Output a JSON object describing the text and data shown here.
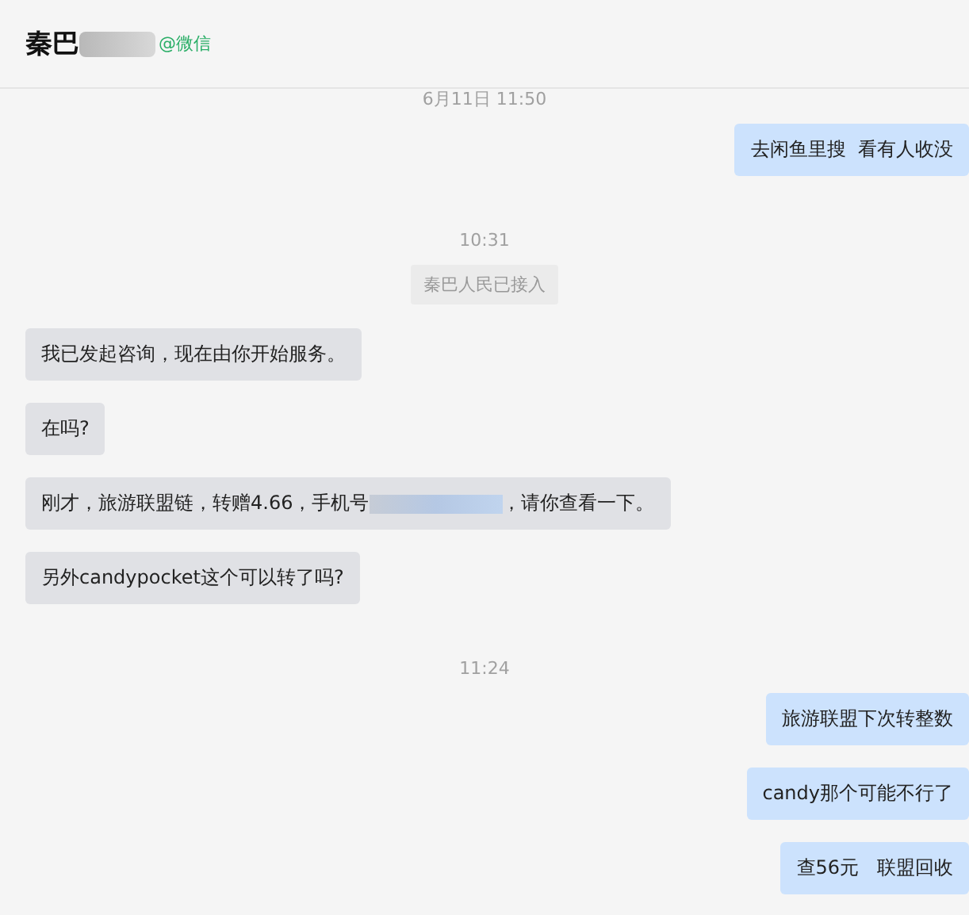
{
  "header": {
    "title": "秦巴",
    "source": "@微信"
  },
  "messages": [
    {
      "kind": "time",
      "text": "6月11日 11:50"
    },
    {
      "kind": "out",
      "parts": [
        {
          "kind": "text",
          "text": "去闲鱼里搜  看有人收没"
        }
      ]
    },
    {
      "kind": "time",
      "text": "10:31"
    },
    {
      "kind": "system",
      "text": "秦巴人民已接入"
    },
    {
      "kind": "in",
      "parts": [
        {
          "kind": "text",
          "text": "我已发起咨询，现在由你开始服务。"
        }
      ]
    },
    {
      "kind": "in",
      "parts": [
        {
          "kind": "text",
          "text": "在吗?"
        }
      ]
    },
    {
      "kind": "in",
      "parts": [
        {
          "kind": "text",
          "text": "刚才，旅游联盟链，转赠4.66，手机号"
        },
        {
          "kind": "redacted"
        },
        {
          "kind": "text",
          "text": "，请你查看一下。"
        }
      ]
    },
    {
      "kind": "in",
      "parts": [
        {
          "kind": "text",
          "text": "另外candypocket这个可以转了吗?"
        }
      ]
    },
    {
      "kind": "time",
      "text": "11:24"
    },
    {
      "kind": "out",
      "parts": [
        {
          "kind": "text",
          "text": "旅游联盟下次转整数"
        }
      ]
    },
    {
      "kind": "out",
      "parts": [
        {
          "kind": "text",
          "text": "candy那个可能不行了"
        }
      ]
    },
    {
      "kind": "out",
      "parts": [
        {
          "kind": "text",
          "text": "查56元   联盟回收"
        }
      ]
    }
  ]
}
